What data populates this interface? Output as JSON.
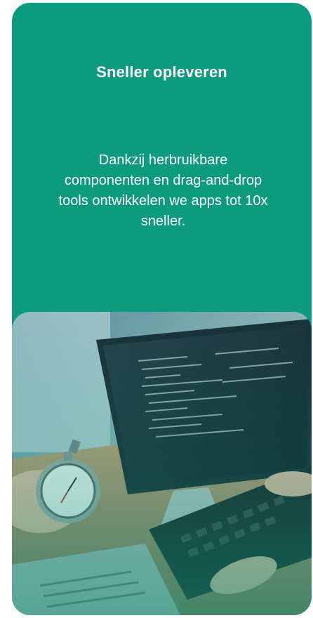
{
  "card": {
    "title": "Sneller opleveren",
    "description": "Dankzij herbruikbare componenten en drag-and-drop tools ontwikkelen we apps tot 10x sneller.",
    "accent_color": "#0d9b7f"
  },
  "image": {
    "subject": "developer-at-computer-with-stopwatch"
  }
}
